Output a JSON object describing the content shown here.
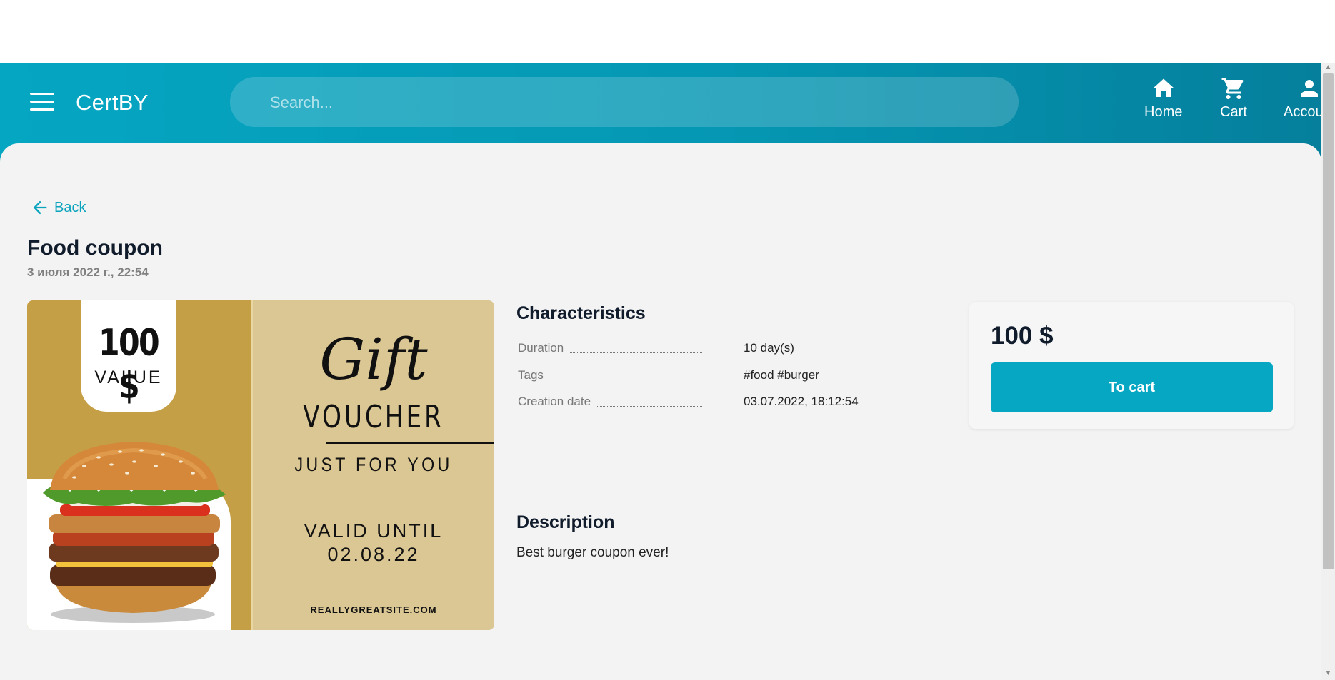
{
  "header": {
    "brand": "CertBY",
    "search_placeholder": "Search...",
    "nav": {
      "home": "Home",
      "cart": "Cart",
      "account": "Account"
    }
  },
  "page": {
    "back_label": "Back",
    "title": "Food coupon",
    "date": "3 июля 2022 г., 22:54"
  },
  "voucher_image": {
    "value_amount": "100 $",
    "value_label": "VALUE",
    "gift": "Gift",
    "voucher": "VOUCHER",
    "just_for_you": "JUST FOR YOU",
    "valid_until": "VALID UNTIL",
    "valid_date": "02.08.22",
    "site": "REALLYGREATSITE.COM"
  },
  "characteristics": {
    "title": "Characteristics",
    "rows": [
      {
        "label": "Duration",
        "value": "10 day(s)"
      },
      {
        "label": "Tags",
        "value": "#food #burger"
      },
      {
        "label": "Creation date",
        "value": "03.07.2022, 18:12:54"
      }
    ]
  },
  "description": {
    "title": "Description",
    "text": "Best burger coupon ever!"
  },
  "purchase": {
    "price": "100 $",
    "button": "To cart"
  },
  "colors": {
    "accent": "#06a7c3",
    "header_start": "#05a6c2",
    "header_end": "#057f9c",
    "voucher_gold": "#c59f45",
    "voucher_beige": "#dbc794"
  }
}
